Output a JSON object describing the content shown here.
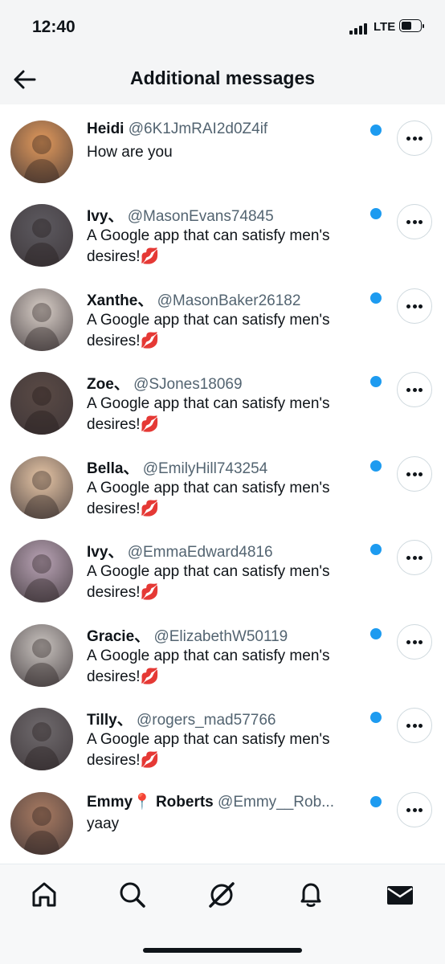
{
  "status_bar": {
    "time": "12:40",
    "network": "LTE"
  },
  "header": {
    "title": "Additional messages",
    "back_icon": "arrow-left-icon"
  },
  "messages": [
    {
      "name": "Heidi",
      "handle": "@6K1JmRAI2d0Z4if",
      "text": "How are you",
      "unread": true,
      "avatar_color": "#e39a5c"
    },
    {
      "name": "Ivy、",
      "handle": "@MasonEvans74845",
      "text": "A Google app that can satisfy men's desires!💋",
      "unread": true,
      "avatar_color": "#5d5a60"
    },
    {
      "name": "Xanthe、",
      "handle": "@MasonBaker26182",
      "text": "A Google app that can satisfy men's desires!💋",
      "unread": true,
      "avatar_color": "#d9cfc8"
    },
    {
      "name": "Zoe、",
      "handle": "@SJones18069",
      "text": "A Google app that can satisfy men's desires!💋",
      "unread": true,
      "avatar_color": "#5a4a45"
    },
    {
      "name": "Bella、",
      "handle": "@EmilyHill743254",
      "text": "A Google app that can satisfy men's desires!💋",
      "unread": true,
      "avatar_color": "#e7c6a6"
    },
    {
      "name": "Ivy、",
      "handle": "@EmmaEdward4816",
      "text": "A Google app that can satisfy men's desires!💋",
      "unread": true,
      "avatar_color": "#b9a3b5"
    },
    {
      "name": "Gracie、",
      "handle": "@ElizabethW50119",
      "text": "A Google app that can satisfy men's desires!💋",
      "unread": true,
      "avatar_color": "#c8c2be"
    },
    {
      "name": "Tilly、",
      "handle": "@rogers_mad57766",
      "text": "A Google app that can satisfy men's desires!💋",
      "unread": true,
      "avatar_color": "#6f6a6d"
    },
    {
      "name": "Emmy📍 Roberts",
      "handle": "@Emmy__Rob...",
      "text": "yaay",
      "unread": true,
      "avatar_color": "#a97b62"
    }
  ],
  "tab_bar": {
    "tabs": [
      {
        "name": "home-icon",
        "label": "Home"
      },
      {
        "name": "search-icon",
        "label": "Search"
      },
      {
        "name": "grok-icon",
        "label": "Grok"
      },
      {
        "name": "bell-icon",
        "label": "Notifications"
      },
      {
        "name": "mail-icon",
        "label": "Messages"
      }
    ]
  },
  "colors": {
    "accent": "#1d9bf0",
    "text": "#0f1419",
    "muted": "#536471"
  }
}
